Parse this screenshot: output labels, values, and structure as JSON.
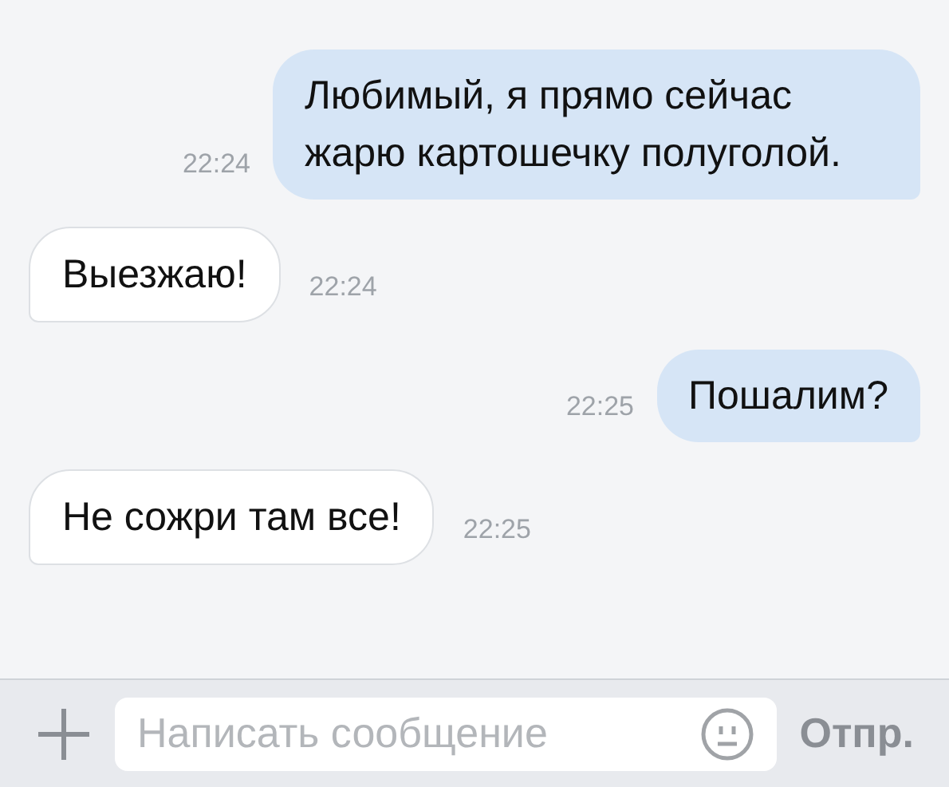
{
  "messages": [
    {
      "kind": "outgoing",
      "text": "Любимый, я прямо сейчас жарю картошечку полуголой.",
      "time": "22:24"
    },
    {
      "kind": "incoming",
      "text": "Выезжаю!",
      "time": "22:24"
    },
    {
      "kind": "outgoing",
      "text": "Пошалим?",
      "time": "22:25"
    },
    {
      "kind": "incoming",
      "text": "Не сожри там все!",
      "time": "22:25"
    }
  ],
  "composer": {
    "placeholder": "Написать сообщение",
    "send": "Отпр."
  }
}
